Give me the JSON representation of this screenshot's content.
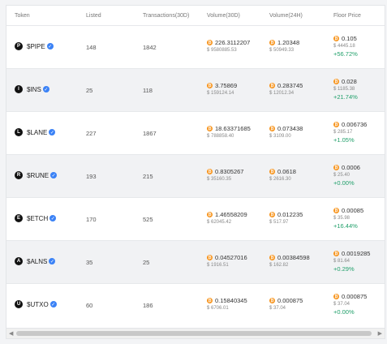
{
  "columns": {
    "token": "Token",
    "listed": "Listed",
    "transactions": "Transactions(30D)",
    "volume30": "Volume(30D)",
    "volume24": "Volume(24H)",
    "floor": "Floor Price"
  },
  "colors": {
    "bitcoin": "#f7931a",
    "positive": "#22a06b",
    "verified": "#3b82f6"
  },
  "icons": {
    "bitcoin": "bitcoin-icon",
    "verified": "verified-check-icon"
  },
  "rows": [
    {
      "icon_letter": "P",
      "name": "$PIPE",
      "listed": "148",
      "tx": "1842",
      "vol30_btc": "226.3112207",
      "vol30_usd": "$ 9580885.53",
      "vol24_btc": "1.20348",
      "vol24_usd": "$ 50949.33",
      "floor_btc": "0.105",
      "floor_usd": "$ 4445.18",
      "change": "+56.72%"
    },
    {
      "icon_letter": "I",
      "name": "$INS",
      "listed": "25",
      "tx": "118",
      "vol30_btc": "3.75869",
      "vol30_usd": "$ 159124.14",
      "vol24_btc": "0.283745",
      "vol24_usd": "$ 12012.34",
      "floor_btc": "0.028",
      "floor_usd": "$ 1185.38",
      "change": "+21.74%"
    },
    {
      "icon_letter": "L",
      "name": "$LANE",
      "listed": "227",
      "tx": "1867",
      "vol30_btc": "18.63371685",
      "vol30_usd": "$ 788858.40",
      "vol24_btc": "0.073438",
      "vol24_usd": "$ 3109.00",
      "floor_btc": "0.006736",
      "floor_usd": "$ 285.17",
      "change": "+1.05%"
    },
    {
      "icon_letter": "R",
      "name": "$RUNE",
      "listed": "193",
      "tx": "215",
      "vol30_btc": "0.8305267",
      "vol30_usd": "$ 35160.35",
      "vol24_btc": "0.0618",
      "vol24_usd": "$ 2616.30",
      "floor_btc": "0.0006",
      "floor_usd": "$ 25.40",
      "change": "+0.00%"
    },
    {
      "icon_letter": "E",
      "name": "$ETCH",
      "listed": "170",
      "tx": "525",
      "vol30_btc": "1.46558209",
      "vol30_usd": "$ 62045.42",
      "vol24_btc": "0.012235",
      "vol24_usd": "$ 517.97",
      "floor_btc": "0.00085",
      "floor_usd": "$ 35.98",
      "change": "+16.44%"
    },
    {
      "icon_letter": "A",
      "name": "$ALNS",
      "listed": "35",
      "tx": "25",
      "vol30_btc": "0.04527016",
      "vol30_usd": "$ 1916.51",
      "vol24_btc": "0.00384598",
      "vol24_usd": "$ 162.82",
      "floor_btc": "0.0019285",
      "floor_usd": "$ 81.64",
      "change": "+0.29%"
    },
    {
      "icon_letter": "U",
      "name": "$UTXO",
      "listed": "60",
      "tx": "186",
      "vol30_btc": "0.15840345",
      "vol30_usd": "$ 6706.01",
      "vol24_btc": "0.000875",
      "vol24_usd": "$ 37.04",
      "floor_btc": "0.000875",
      "floor_usd": "$ 37.04",
      "change": "+0.00%"
    }
  ]
}
